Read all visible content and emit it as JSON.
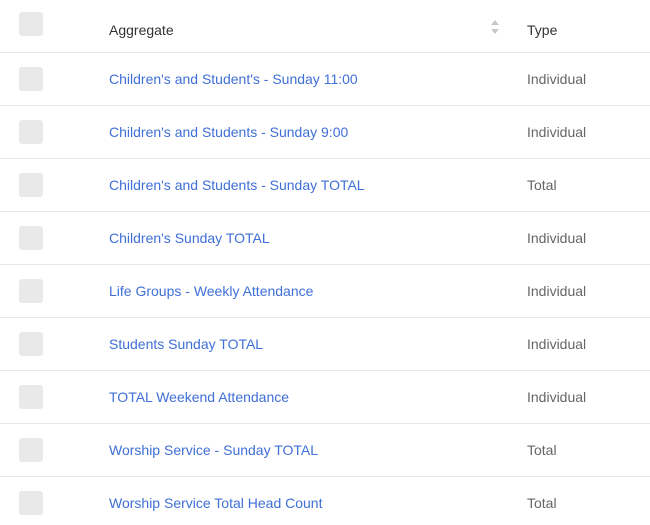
{
  "table": {
    "header": {
      "aggregate_label": "Aggregate",
      "type_label": "Type"
    },
    "rows": [
      {
        "aggregate": "Children's and Student's - Sunday 11:00",
        "type": "Individual"
      },
      {
        "aggregate": "Children's and Students - Sunday 9:00",
        "type": "Individual"
      },
      {
        "aggregate": "Children's and Students - Sunday TOTAL",
        "type": "Total"
      },
      {
        "aggregate": "Children's Sunday TOTAL",
        "type": "Individual"
      },
      {
        "aggregate": "Life Groups - Weekly Attendance",
        "type": "Individual"
      },
      {
        "aggregate": "Students Sunday TOTAL",
        "type": "Individual"
      },
      {
        "aggregate": "TOTAL Weekend Attendance",
        "type": "Individual"
      },
      {
        "aggregate": "Worship Service - Sunday TOTAL",
        "type": "Total"
      },
      {
        "aggregate": "Worship Service Total Head Count",
        "type": "Total"
      }
    ]
  },
  "colors": {
    "link": "#3f6fd8",
    "checkbox": "#e9e9ea",
    "divider": "#e6e6e6"
  }
}
